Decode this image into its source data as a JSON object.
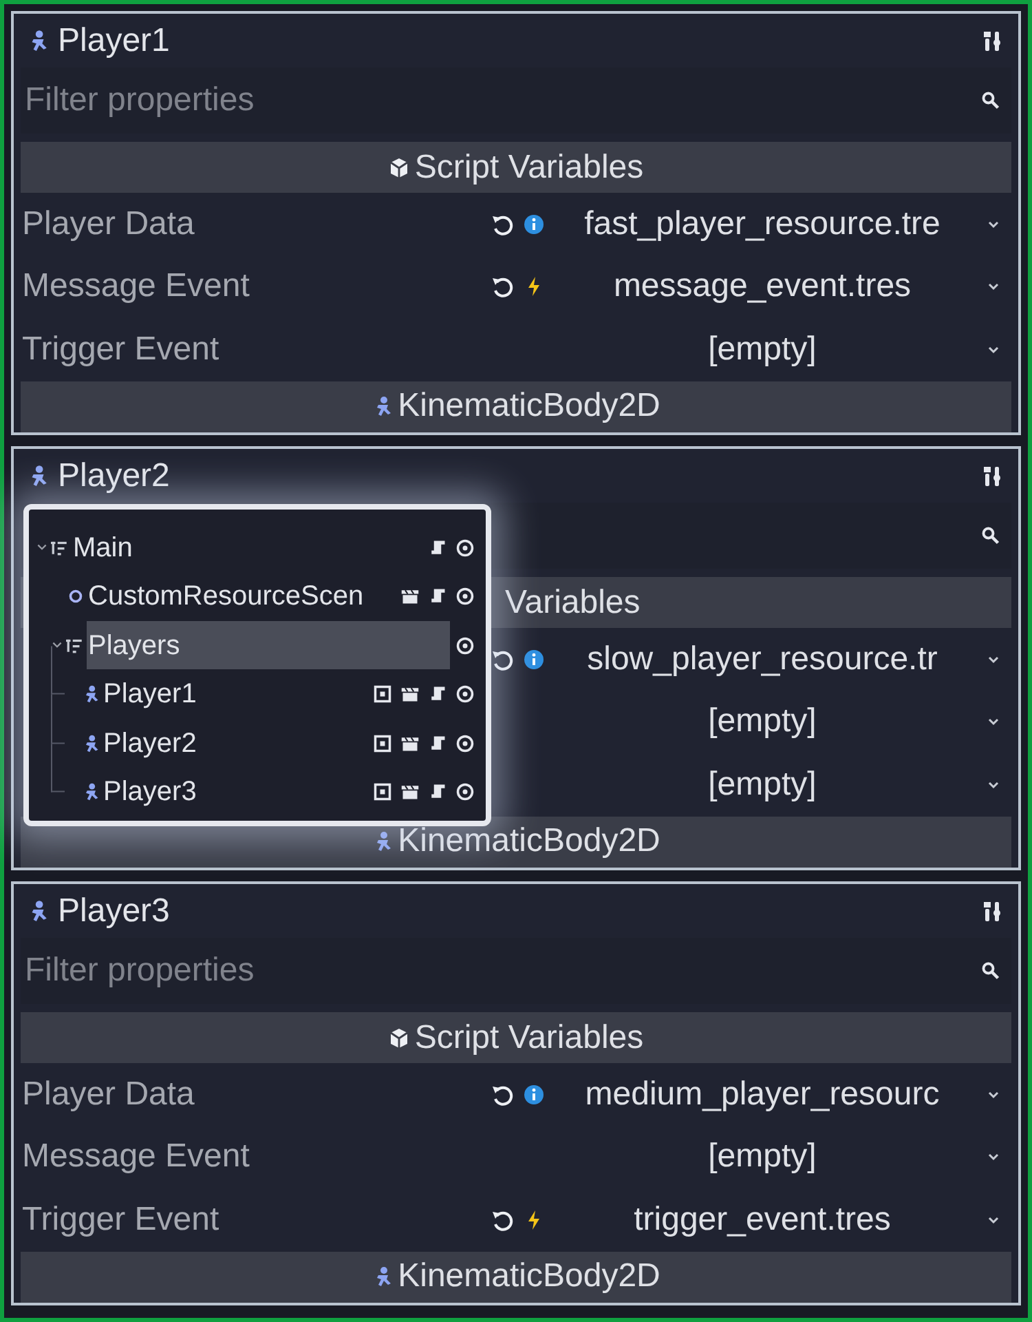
{
  "panels": [
    {
      "title": "Player1",
      "filter": {
        "placeholder": "Filter properties"
      },
      "section": "Script Variables",
      "properties": [
        {
          "label": "Player Data",
          "value": "fast_player_resource.tre",
          "revert": true,
          "kind": "data"
        },
        {
          "label": "Message Event",
          "value": "message_event.tres",
          "revert": true,
          "kind": "event"
        },
        {
          "label": "Trigger Event",
          "value": "[empty]",
          "revert": false,
          "kind": "empty"
        }
      ],
      "footer": "KinematicBody2D"
    },
    {
      "title": "Player2",
      "section": "Variables",
      "properties": [
        {
          "value": "slow_player_resource.tr",
          "revert": true,
          "kind": "data"
        },
        {
          "value": "[empty]",
          "revert": false,
          "kind": "empty"
        },
        {
          "value": "[empty]",
          "revert": false,
          "kind": "empty"
        }
      ],
      "footer": "KinematicBody2D",
      "scene_tree_popup": {
        "items": [
          {
            "label": "Main",
            "kind": "group",
            "expanded": true,
            "selected": false,
            "instanced": false,
            "signals": false,
            "script": true,
            "visible": true,
            "children": [
              {
                "label": "CustomResourceScen",
                "kind": "circle",
                "selected": false,
                "instanced": false,
                "signals": true,
                "script": true,
                "visible": true
              },
              {
                "label": "Players",
                "kind": "group",
                "expanded": true,
                "selected": true,
                "instanced": false,
                "signals": false,
                "script": false,
                "visible": true,
                "children": [
                  {
                    "label": "Player1",
                    "kind": "body",
                    "selected": false,
                    "instanced": true,
                    "signals": true,
                    "script": true,
                    "visible": true
                  },
                  {
                    "label": "Player2",
                    "kind": "body",
                    "selected": false,
                    "instanced": true,
                    "signals": true,
                    "script": true,
                    "visible": true
                  },
                  {
                    "label": "Player3",
                    "kind": "body",
                    "selected": false,
                    "instanced": true,
                    "signals": true,
                    "script": true,
                    "visible": true
                  }
                ]
              }
            ]
          }
        ]
      }
    },
    {
      "title": "Player3",
      "filter": {
        "placeholder": "Filter properties"
      },
      "section": "Script Variables",
      "properties": [
        {
          "label": "Player Data",
          "value": "medium_player_resourc",
          "revert": true,
          "kind": "data"
        },
        {
          "label": "Message Event",
          "value": "[empty]",
          "revert": false,
          "kind": "empty"
        },
        {
          "label": "Trigger Event",
          "value": "trigger_event.tres",
          "revert": true,
          "kind": "event"
        }
      ],
      "footer": "KinematicBody2D"
    }
  ]
}
